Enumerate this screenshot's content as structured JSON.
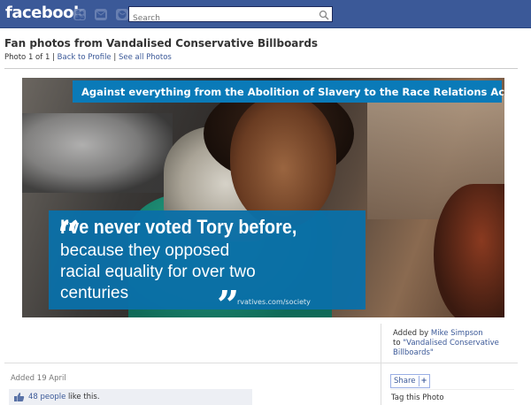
{
  "topbar": {
    "logo": "facebook",
    "search_placeholder": "Search",
    "colors": {
      "bar": "#3b5998"
    }
  },
  "header": {
    "title": "Fan photos from Vandalised Conservative Billboards",
    "photo_count": "Photo 1 of 1",
    "sep": " | ",
    "back_link": "Back to Profile",
    "see_all_link": "See all Photos"
  },
  "photo": {
    "banner_top": "Against everything from the Abolition of Slavery to the Race Relations Act.",
    "quote_headline": "I've never voted Tory before,",
    "quote_lines": [
      "because they opposed",
      "racial equality for over two",
      "centuries"
    ],
    "url_text": "rvatives.com/society",
    "colors": {
      "banner": "#0a7ab8"
    }
  },
  "sidebar": {
    "added_by_prefix": "Added by ",
    "added_by_name": "Mike Simpson",
    "to_prefix": "to ",
    "to_album": "\"Vandalised Conservative Billboards\"",
    "share_label": "Share",
    "share_plus": "+",
    "tag_label": "Tag this Photo"
  },
  "footer": {
    "added_date": "Added 19 April",
    "likes_count": "48 people",
    "likes_suffix": " like this."
  },
  "icons": [
    "friends-icon",
    "messages-icon",
    "notifications-icon",
    "search-icon",
    "conservative-tree-icon",
    "like-thumb-icon"
  ]
}
